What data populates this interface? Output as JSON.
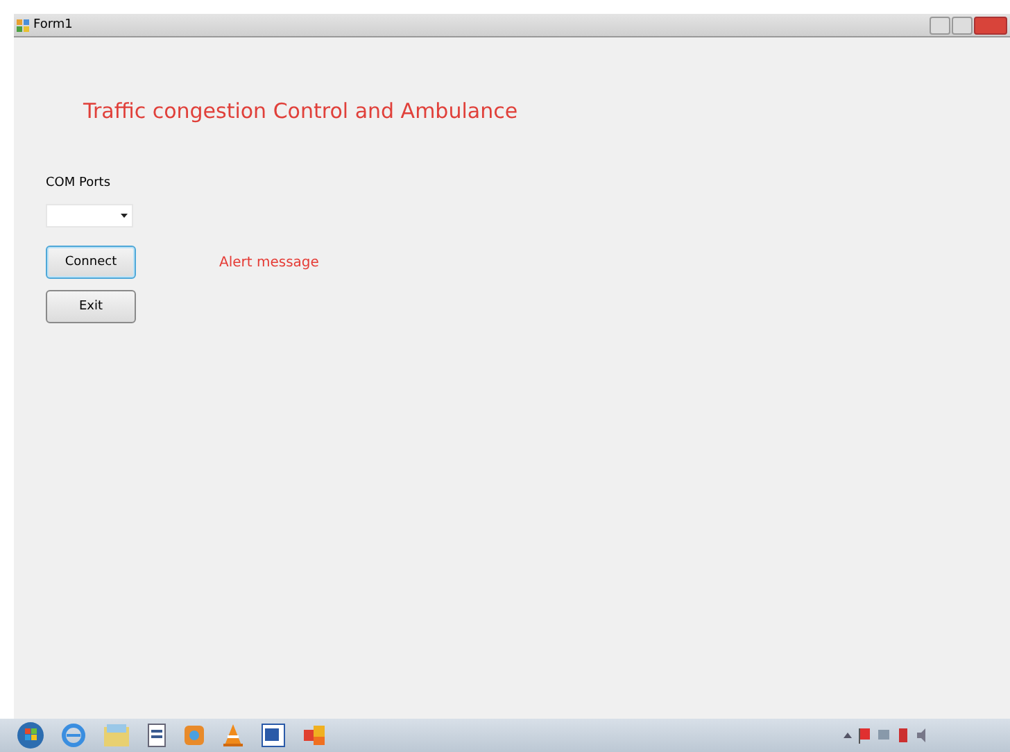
{
  "window": {
    "title": "Form1"
  },
  "heading": "Traffic congestion Control and Ambulance",
  "com_ports": {
    "label": "COM Ports"
  },
  "buttons": [
    {
      "label": "Connect",
      "focused": true
    },
    {
      "label": "Exit",
      "focused": false
    }
  ],
  "alert": "Alert message"
}
